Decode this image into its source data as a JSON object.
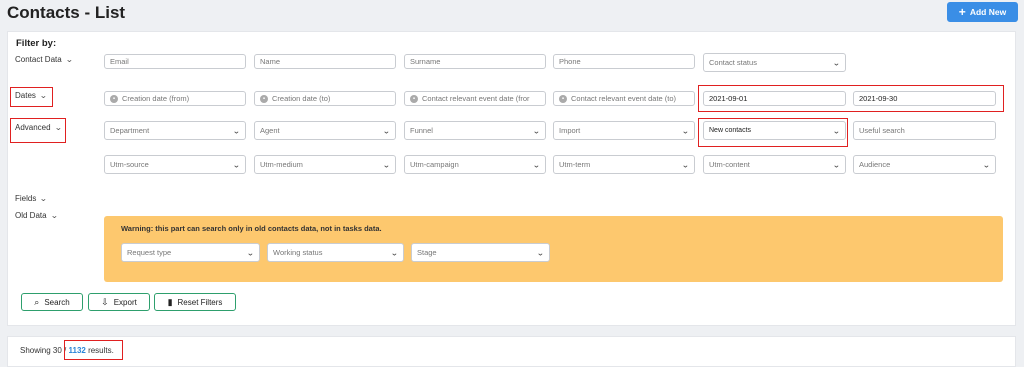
{
  "header": {
    "title": "Contacts - List",
    "add_label": "Add New",
    "add_icon": "plus-icon",
    "accent": "#3a8ee6"
  },
  "filters": {
    "filter_by_label": "Filter by:",
    "sections": {
      "contact_data": "Contact Data",
      "dates": "Dates",
      "advanced": "Advanced",
      "fields": "Fields",
      "old_data": "Old Data"
    },
    "contact_row": {
      "email_placeholder": "Email",
      "name_placeholder": "Name",
      "surname_placeholder": "Surname",
      "phone_placeholder": "Phone",
      "status_placeholder": "Contact status"
    },
    "dates_row": {
      "creation_from": "Creation date (from)",
      "creation_to": "Creation date (to)",
      "event_from": "Contact relevant event date (fror",
      "event_to": "Contact relevant event date (to)",
      "date_from_value": "2021-09-01",
      "date_to_value": "2021-09-30"
    },
    "advanced_row": {
      "department": "Department",
      "agent": "Agent",
      "funnel": "Funnel",
      "import": "Import",
      "new_contacts": "New contacts",
      "useful_search": "Useful search"
    },
    "utm_row": {
      "source": "Utm-source",
      "medium": "Utm-medium",
      "campaign": "Utm-campaign",
      "term": "Utm-term",
      "content": "Utm-content",
      "audience": "Audience"
    },
    "old_data": {
      "warning": "Warning: this part can search only in old contacts data, not in tasks data.",
      "warning_color": "#fdc86e",
      "request_type": "Request type",
      "working_status": "Working status",
      "stage": "Stage"
    },
    "actions": {
      "search": "Search",
      "export": "Export",
      "reset": "Reset Filters",
      "button_border": "#2e9f6d"
    }
  },
  "results": {
    "prefix": "Showing 30 / ",
    "count": "1132",
    "suffix": " results."
  },
  "highlight_color": "#e02020"
}
